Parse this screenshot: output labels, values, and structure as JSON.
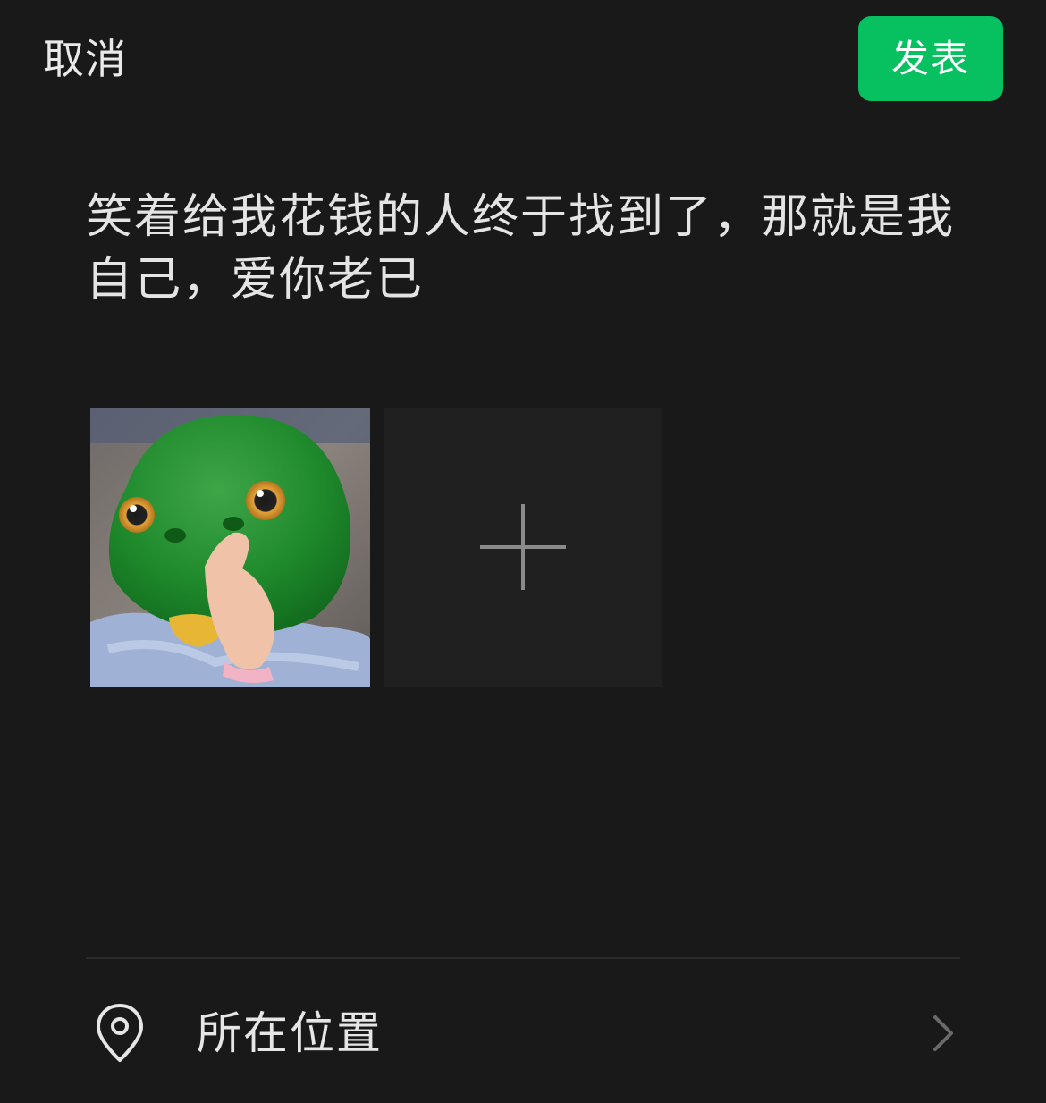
{
  "header": {
    "cancel_label": "取消",
    "publish_label": "发表",
    "accent_color": "#07c160"
  },
  "post": {
    "text": "笑着给我花钱的人终于找到了，那就是我自己，爱你老已"
  },
  "photos": {
    "items": [
      {
        "description_icon": "photo-thumbnail"
      }
    ],
    "add_icon": "plus-icon"
  },
  "location": {
    "label": "所在位置",
    "icon": "location-pin-icon",
    "chevron_icon": "chevron-right-icon"
  }
}
